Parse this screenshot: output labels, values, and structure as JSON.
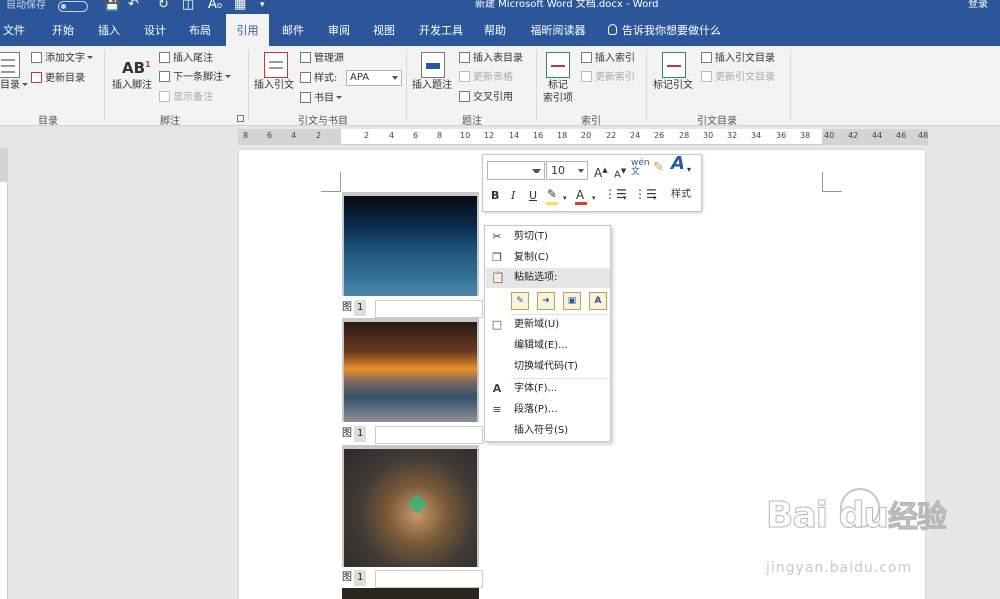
{
  "titlebar": {
    "autosave": "自动保存",
    "title": "新建 Microsoft Word 文档.docx  -  Word",
    "login": "登录"
  },
  "tabs": [
    "文件",
    "开始",
    "插入",
    "设计",
    "布局",
    "引用",
    "邮件",
    "审阅",
    "视图",
    "开发工具",
    "帮助",
    "福昕阅读器"
  ],
  "active_tab": "引用",
  "tellme": "告诉我你想要做什么",
  "ribbon": {
    "toc": {
      "label": "目录",
      "add_text": "添加文字",
      "update": "更新目录",
      "group": "目录"
    },
    "footnote": {
      "insert_footnote": "插入脚注",
      "insert_endnote": "插入尾注",
      "next_footnote": "下一条脚注",
      "show_notes": "显示备注",
      "group": "脚注"
    },
    "citation": {
      "insert_citation": "插入引文",
      "manage_sources": "管理源",
      "style_label": "样式:",
      "style_value": "APA",
      "bibliography": "书目",
      "group": "引文与书目"
    },
    "caption": {
      "insert_caption": "插入题注",
      "insert_tof": "插入表目录",
      "update_table": "更新表格",
      "cross_ref": "交叉引用",
      "group": "题注"
    },
    "index": {
      "mark_entry": "标记",
      "mark_entry2": "索引项",
      "insert_index": "插入索引",
      "update_index": "更新索引",
      "group": "索引"
    },
    "toa": {
      "mark_citation": "标记引文",
      "insert_toa": "插入引文目录",
      "update_toa": "更新引文目录",
      "group": "引文目录"
    }
  },
  "ruler_numbers": [
    "8",
    "6",
    "4",
    "2",
    "2",
    "4",
    "6",
    "8",
    "10",
    "12",
    "14",
    "16",
    "18",
    "20",
    "22",
    "24",
    "26",
    "28",
    "30",
    "32",
    "34",
    "36",
    "38",
    "40",
    "42",
    "44",
    "46",
    "48"
  ],
  "captions": [
    {
      "label": "图",
      "num": "1"
    },
    {
      "label": "图",
      "num": "1"
    },
    {
      "label": "图",
      "num": "1"
    }
  ],
  "minitoolbar": {
    "font_name": "",
    "font_size": "10",
    "grow": "A",
    "shrink": "A",
    "wen": "wén\n文",
    "bold": "B",
    "italic": "I",
    "underline": "U",
    "font_color_letter": "A",
    "styles": "样式"
  },
  "context_menu": {
    "cut": "剪切(T)",
    "copy": "复制(C)",
    "paste_header": "粘贴选项:",
    "update_field": "更新域(U)",
    "edit_field": "编辑域(E)...",
    "toggle_codes": "切换域代码(T)",
    "font": "字体(F)...",
    "paragraph": "段落(P)...",
    "insert_symbol": "插入符号(S)"
  },
  "colors": {
    "brand": "#2b579a",
    "highlight": "#f5e447",
    "font_red": "#e03b2f"
  },
  "watermark": {
    "logo": "Bai  du",
    "brand": "经验",
    "url": "jingyan.baidu.com"
  }
}
